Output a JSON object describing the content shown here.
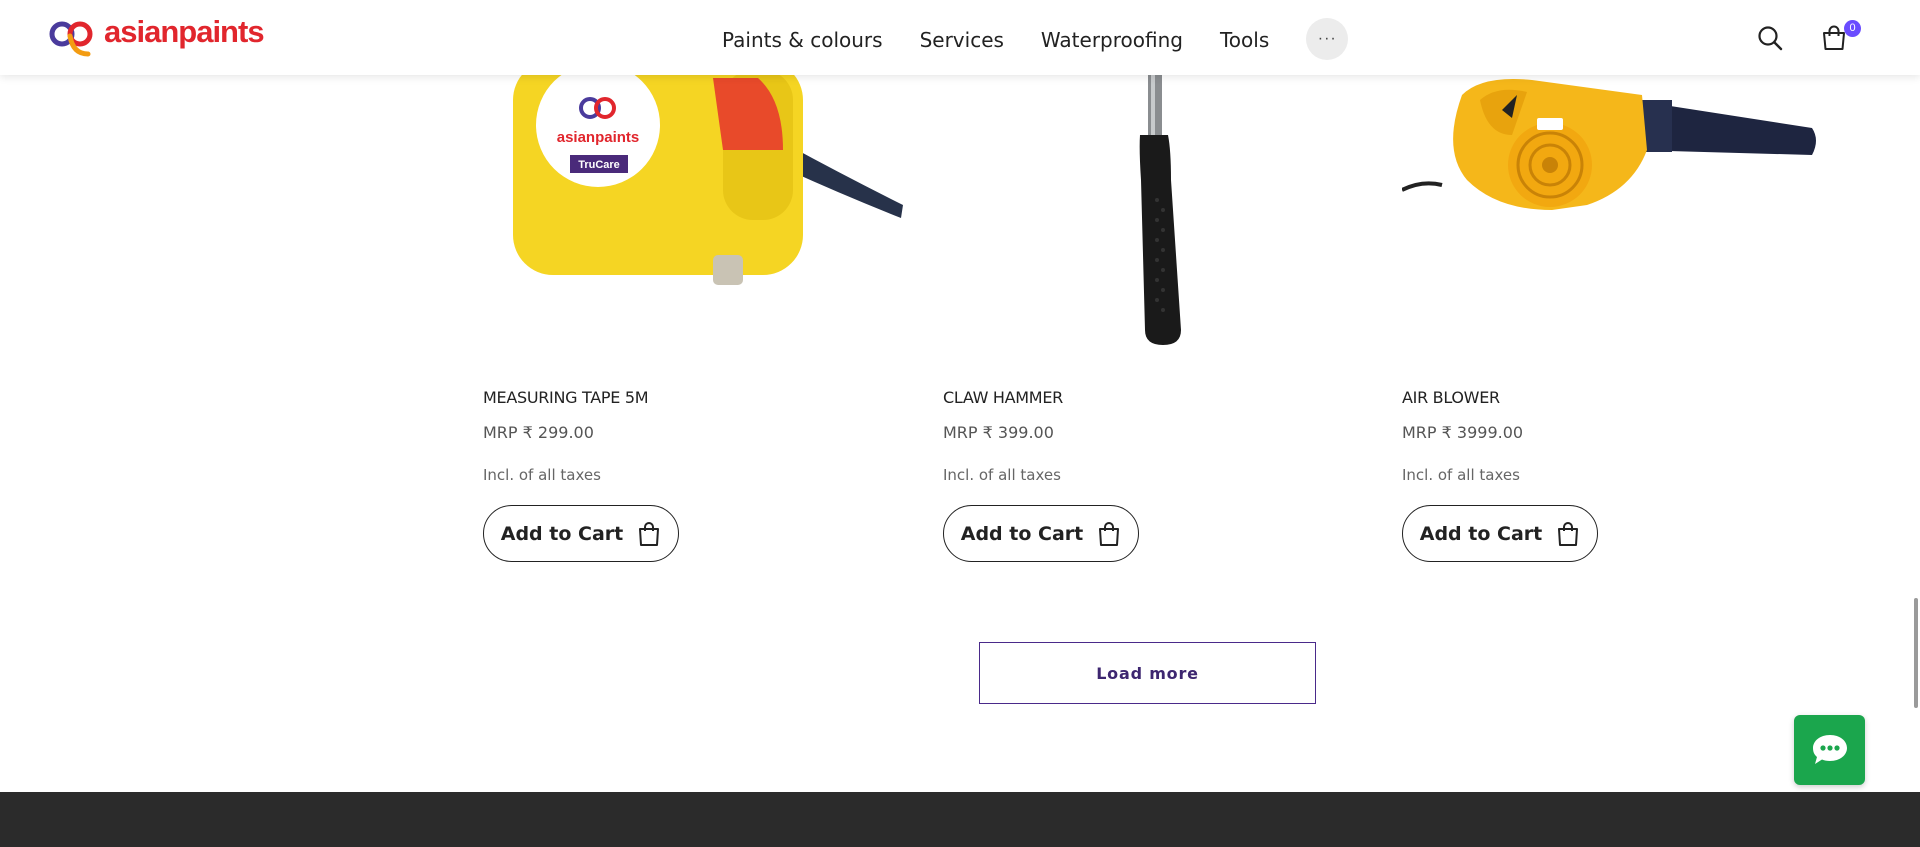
{
  "header": {
    "logo_text": "asianpaints",
    "nav": [
      "Paints & colours",
      "Services",
      "Waterproofing",
      "Tools"
    ],
    "more_label": "···",
    "cart_count": "0"
  },
  "products": [
    {
      "name": "MEASURING TAPE 5M",
      "price": "MRP ₹ 299.00",
      "tax": "Incl. of all taxes",
      "add_label": "Add to Cart",
      "image": "measuring-tape",
      "image_brand_text": "asianpaints",
      "image_badge_text": "TruCare"
    },
    {
      "name": "CLAW HAMMER",
      "price": "MRP ₹ 399.00",
      "tax": "Incl. of all taxes",
      "add_label": "Add to Cart",
      "image": "claw-hammer"
    },
    {
      "name": "AIR BLOWER",
      "price": "MRP ₹ 3999.00",
      "tax": "Incl. of all taxes",
      "add_label": "Add to Cart",
      "image": "air-blower"
    }
  ],
  "load_more_label": "Load more",
  "colors": {
    "brand_red": "#e1262d",
    "brand_purple": "#3d2670",
    "badge": "#6a4cff",
    "chat_green": "#1ba64d",
    "footer": "#2b2b2b"
  }
}
